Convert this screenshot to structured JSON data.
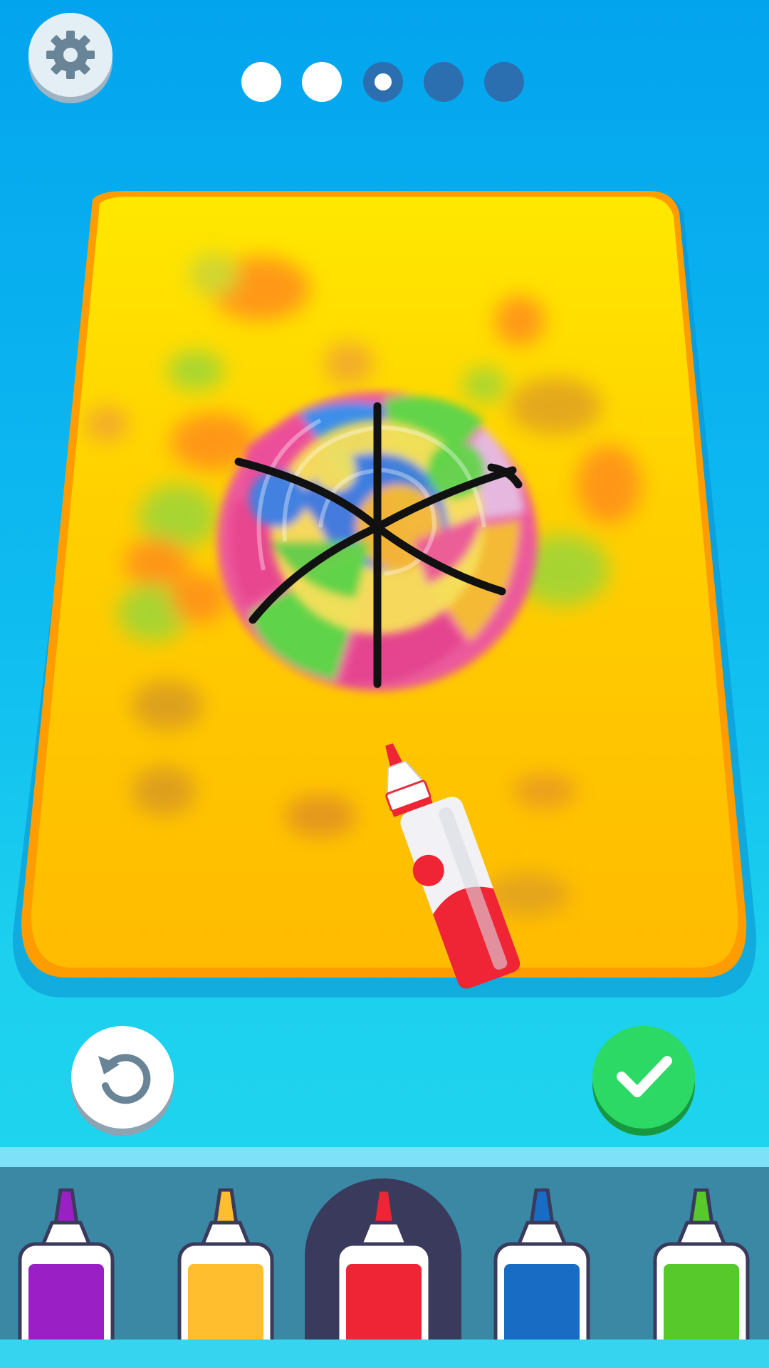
{
  "game": {
    "screen": "tie-dye-painting"
  },
  "progress": {
    "total_steps": 5,
    "current_step": 3,
    "steps": [
      "done",
      "done",
      "current",
      "todo",
      "todo"
    ]
  },
  "buttons": {
    "settings_icon": "gear-icon",
    "undo_icon": "undo-icon",
    "confirm_icon": "checkmark-icon"
  },
  "palette": {
    "selected": "red",
    "colors": [
      {
        "name": "purple",
        "hex": "#9a1fc4"
      },
      {
        "name": "yellow",
        "hex": "#ffbe2e"
      },
      {
        "name": "red",
        "hex": "#ef2435"
      },
      {
        "name": "blue",
        "hex": "#186cc4"
      },
      {
        "name": "green",
        "hex": "#58c92a"
      }
    ]
  },
  "colors": {
    "board": "#ffc400",
    "board_edge": "#ff9f00",
    "background_top": "#03a4ee",
    "confirm": "#2bd964"
  }
}
